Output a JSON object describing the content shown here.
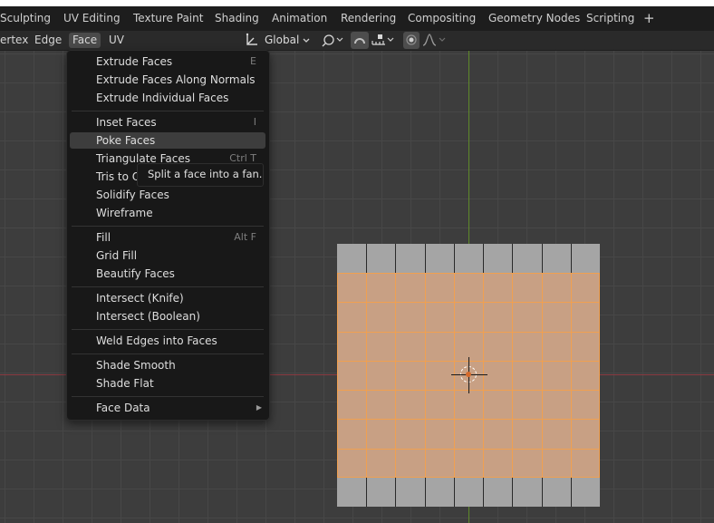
{
  "workspace_tabs": [
    "Sculpting",
    "UV Editing",
    "Texture Paint",
    "Shading",
    "Animation",
    "Rendering",
    "Compositing",
    "Geometry Nodes",
    "Scripting"
  ],
  "workspace_add": "+",
  "header": {
    "menus": [
      "ertex",
      "Edge",
      "Face",
      "UV"
    ],
    "active_menu": "Face",
    "orientation": "Global"
  },
  "face_menu": {
    "items": [
      {
        "label": "Extrude Faces",
        "shortcut": "E"
      },
      {
        "label": "Extrude Faces Along Normals",
        "shortcut": ""
      },
      {
        "label": "Extrude Individual Faces",
        "shortcut": ""
      },
      {
        "label": "Inset Faces",
        "shortcut": "I"
      },
      {
        "label": "Poke Faces",
        "shortcut": ""
      },
      {
        "label": "Triangulate Faces",
        "shortcut": "Ctrl T"
      },
      {
        "label": "Tris to Q",
        "shortcut": ""
      },
      {
        "label": "Solidify Faces",
        "shortcut": ""
      },
      {
        "label": "Wireframe",
        "shortcut": ""
      },
      {
        "label": "Fill",
        "shortcut": "Alt F"
      },
      {
        "label": "Grid Fill",
        "shortcut": ""
      },
      {
        "label": "Beautify Faces",
        "shortcut": ""
      },
      {
        "label": "Intersect (Knife)",
        "shortcut": ""
      },
      {
        "label": "Intersect (Boolean)",
        "shortcut": ""
      },
      {
        "label": "Weld Edges into Faces",
        "shortcut": ""
      },
      {
        "label": "Shade Smooth",
        "shortcut": ""
      },
      {
        "label": "Shade Flat",
        "shortcut": ""
      },
      {
        "label": "Face Data",
        "shortcut": ""
      }
    ],
    "highlighted_item": "Poke Faces",
    "tooltip": "Split a face into a fan."
  },
  "colors": {
    "menu_bg": "#181818",
    "highlight": "#3d3d3d",
    "selection_edge": "#f0a050",
    "x_axis": "#8a3a40",
    "y_axis": "#5f8a2a"
  },
  "icons": [
    "transform-orientation-icon",
    "proportional-link-icon",
    "snap-icon",
    "snap-increment-icon",
    "proportional-editing-icon",
    "falloff-curve-icon",
    "submenu-arrow-icon",
    "3d-cursor-icon"
  ]
}
